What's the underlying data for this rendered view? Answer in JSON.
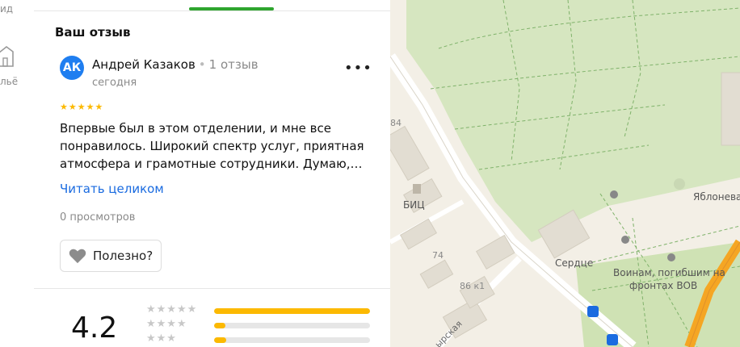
{
  "sidebar": {
    "label1": "ид",
    "label2": "льё"
  },
  "review_section": {
    "title": "Ваш отзыв",
    "avatar_initials": "АК",
    "author_name": "Андрей Казаков",
    "review_count": "1 отзыв",
    "date": "сегодня",
    "stars": 5,
    "text": "Впервые был в этом отделении, и мне все понравилось. Широкий спектр услуг, приятная атмосфера и грамотные сотрудники. Думаю,…",
    "read_more": "Читать целиком",
    "views": "0 просмотров",
    "useful_label": "Полезно?"
  },
  "rating_summary": {
    "value": "4.2",
    "distribution": [
      {
        "stars": 5,
        "fraction": 1.0
      },
      {
        "stars": 4,
        "fraction": 0.07
      },
      {
        "stars": 3,
        "fraction": 0.08
      }
    ]
  },
  "map": {
    "labels": {
      "bic": "БИЦ",
      "apple_grove": "Яблоневая роща",
      "heart": "Сердце",
      "memorial": "Воинам, погибшим на фронтах ВОВ",
      "street": "ырская",
      "house_84": "84",
      "house_74": "74",
      "house_86k1": "86 к1"
    },
    "colors": {
      "park": "#d6e6c0",
      "land": "#f3efe6",
      "road": "#ffffff",
      "highway": "#f5a623"
    }
  }
}
